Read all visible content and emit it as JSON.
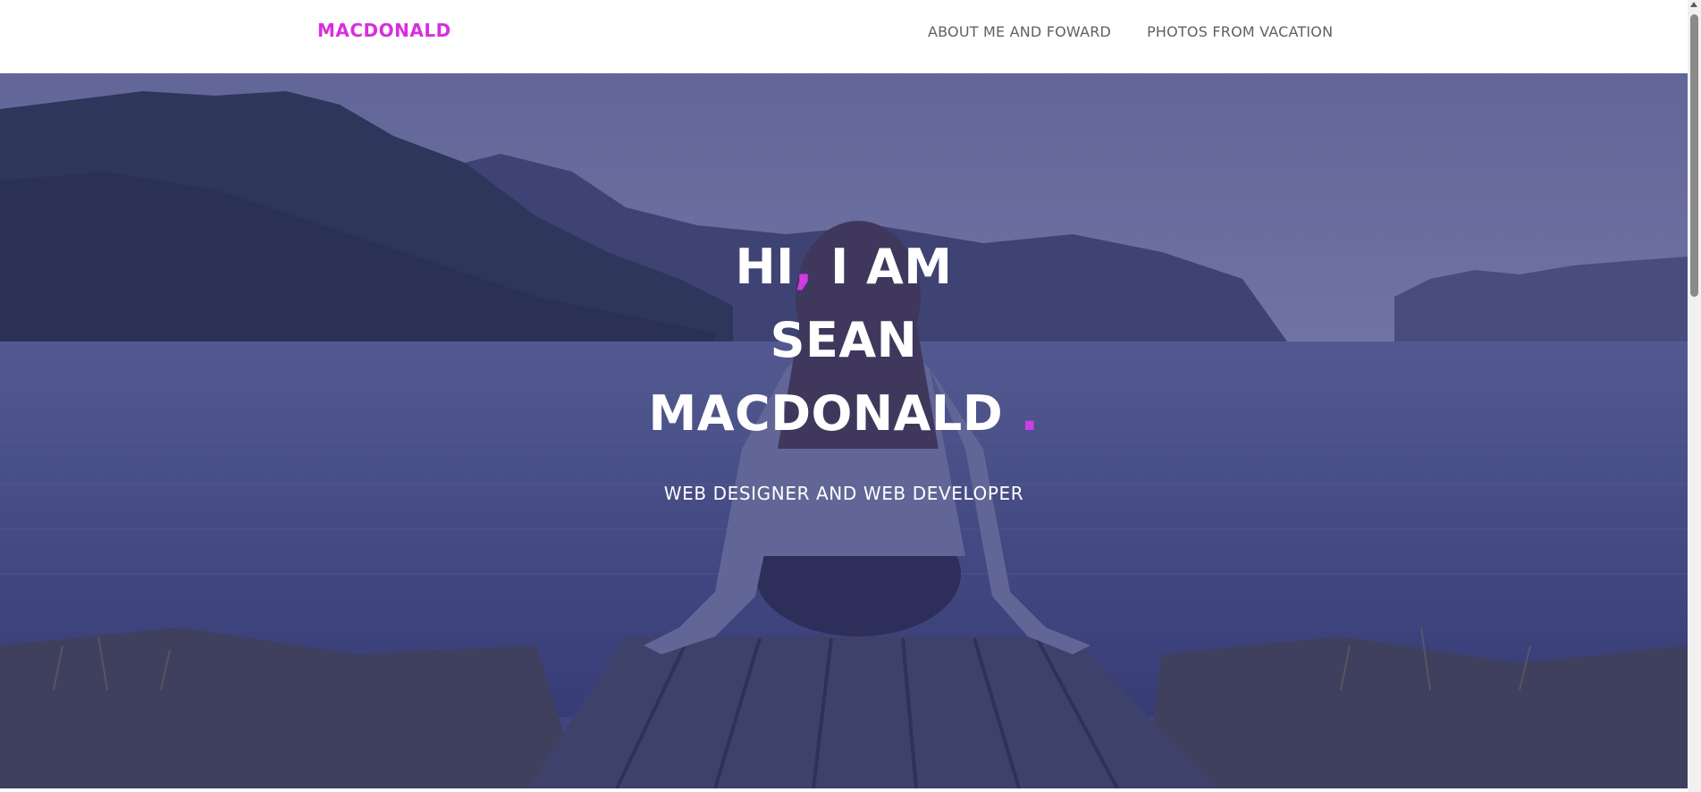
{
  "navbar": {
    "brand": "MACDONALD",
    "links": [
      {
        "label": "ABOUT ME AND FOWARD"
      },
      {
        "label": "PHOTOS FROM VACATION"
      }
    ]
  },
  "hero": {
    "line1_a": "HI",
    "line1_comma": ",",
    "line1_b": " I AM",
    "line2": "SEAN",
    "line3": "MACDONALD ",
    "line3_dot": ".",
    "subtitle": "WEB DESIGNER AND WEB DEVELOPER",
    "image": "woman-sitting-on-dock-by-lake"
  },
  "colors": {
    "brand": "#d82ee0",
    "accent": "#cf3ce6",
    "overlay": "#303478",
    "nav_text": "#5f5f66"
  }
}
